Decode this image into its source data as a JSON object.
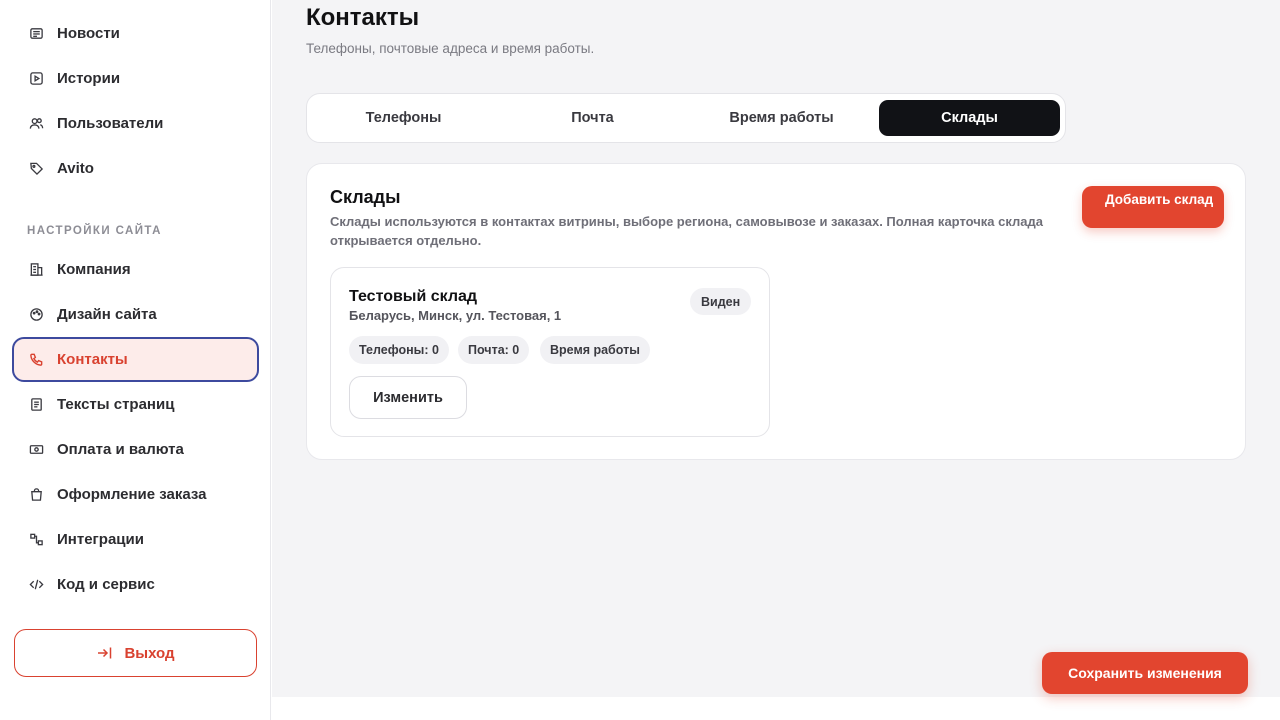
{
  "sidebar": {
    "items_top": [
      {
        "label": "Новости",
        "icon": "newspaper-icon"
      },
      {
        "label": "Истории",
        "icon": "play-square-icon"
      },
      {
        "label": "Пользователи",
        "icon": "users-icon"
      },
      {
        "label": "Avito",
        "icon": "tag-icon"
      }
    ],
    "section_label": "НАСТРОЙКИ САЙТА",
    "items_settings": [
      {
        "label": "Компания",
        "icon": "building-icon"
      },
      {
        "label": "Дизайн сайта",
        "icon": "palette-icon"
      },
      {
        "label": "Контакты",
        "icon": "phone-icon",
        "active": true
      },
      {
        "label": "Тексты страниц",
        "icon": "document-icon"
      },
      {
        "label": "Оплата и валюта",
        "icon": "banknote-icon"
      },
      {
        "label": "Оформление заказа",
        "icon": "shopping-bag-icon"
      },
      {
        "label": "Интеграции",
        "icon": "workflow-icon"
      },
      {
        "label": "Код и сервис",
        "icon": "code-icon"
      }
    ],
    "logout_label": "Выход"
  },
  "header": {
    "title": "Контакты",
    "subtitle": "Телефоны, почтовые адреса и время работы."
  },
  "tabs": [
    {
      "label": "Телефоны"
    },
    {
      "label": "Почта"
    },
    {
      "label": "Время работы"
    },
    {
      "label": "Склады",
      "active": true
    }
  ],
  "warehouses_section": {
    "title": "Склады",
    "description": "Склады используются в контактах витрины, выборе региона, самовывозе и заказах. Полная карточка склада открывается отдельно.",
    "add_button_label": "Добавить склад",
    "items": [
      {
        "name": "Тестовый склад",
        "address": "Беларусь, Минск, ул. Тестовая, 1",
        "visibility_badge": "Виден",
        "chips": [
          "Телефоны: 0",
          "Почта: 0",
          "Время работы"
        ],
        "edit_label": "Изменить"
      }
    ]
  },
  "save_button_label": "Сохранить изменения",
  "colors": {
    "accent": "#e2452f",
    "active_border": "#3d4a9e",
    "active_bg": "#fdecea",
    "tab_active_bg": "#111216",
    "main_bg": "#f4f4f6"
  }
}
